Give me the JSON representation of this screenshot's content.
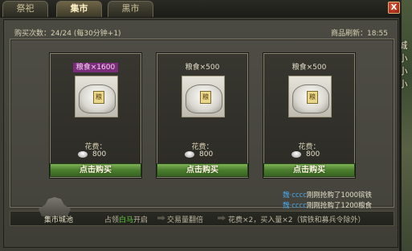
{
  "tabs": [
    {
      "label": "祭祀"
    },
    {
      "label": "集市"
    },
    {
      "label": "黑市"
    }
  ],
  "active_tab": "集市",
  "close_label": "X",
  "header": {
    "buy_count_label": "购买次数：",
    "buy_count_value": "24/24",
    "buy_count_note": "(每30分钟+1)",
    "refresh_label": "商品刷新：",
    "refresh_time": "18:55"
  },
  "cards": [
    {
      "title": "粮食×1600",
      "highlight": true,
      "bag_text": "粮",
      "cost_label": "花费：",
      "cost_value": "800",
      "button": "点击购买"
    },
    {
      "title": "粮食×500",
      "highlight": false,
      "bag_text": "粮",
      "cost_label": "花费：",
      "cost_value": "800",
      "button": "点击购买"
    },
    {
      "title": "粮食×500",
      "highlight": false,
      "bag_text": "粮",
      "cost_label": "花费：",
      "cost_value": "800",
      "button": "点击购买"
    }
  ],
  "log": [
    {
      "name": "魏·cccc",
      "text": "刚刚抢购了1000镔铁"
    },
    {
      "name": "魏·cccc",
      "text": "刚刚抢购了1200粮食"
    }
  ],
  "bottom": {
    "castle_label": "集市城池",
    "step1_prefix": "占领",
    "step1_highlight": "白马",
    "step1_suffix": "开启",
    "step2": "交易量翻倍",
    "step3": "花费×2，买入量×2（镔铁和募兵令除外）"
  },
  "map_labels": [
    "城",
    "小",
    "小",
    "小"
  ],
  "colors": {
    "buy_button": "#4a7d2c",
    "highlight_title": "#7b2c7a",
    "log_name": "#49a7e8",
    "highlight_city": "#5ecf3a"
  }
}
